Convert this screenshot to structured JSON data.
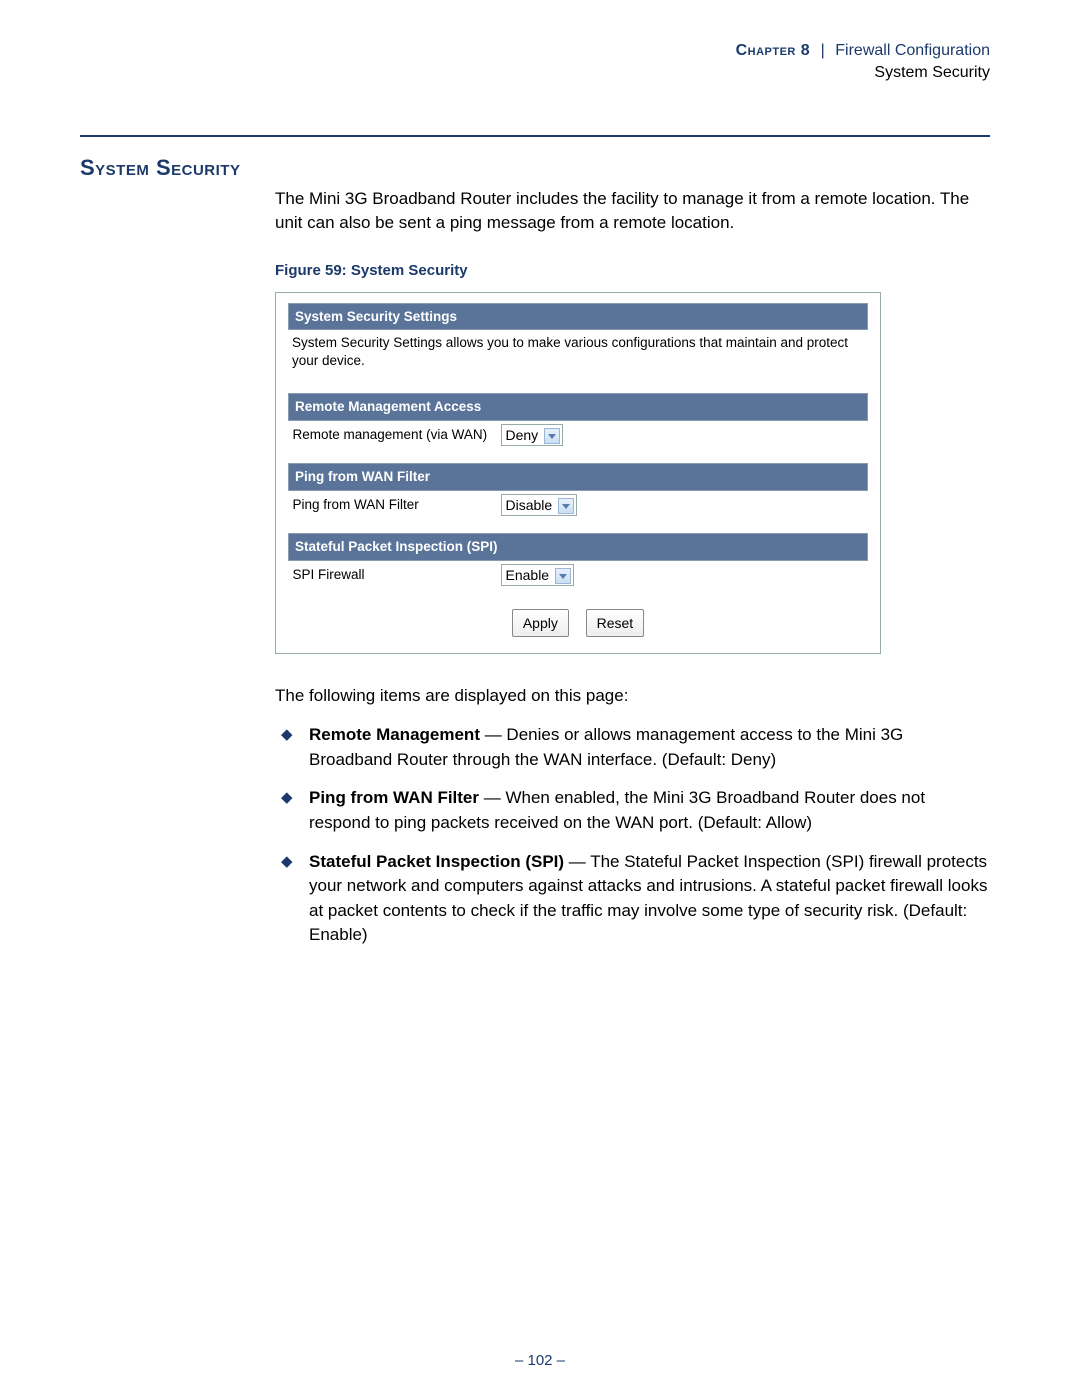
{
  "header": {
    "chapter_label": "Chapter 8",
    "separator": "|",
    "chapter_title": "Firewall Configuration",
    "subsection": "System Security"
  },
  "section_title": "System Security",
  "intro_paragraph": "The Mini 3G Broadband Router includes the facility to manage it from a remote location. The unit can also be sent a ping message from a remote location.",
  "figure_caption": "Figure 59:  System Security",
  "screenshot": {
    "main_title": "System Security Settings",
    "main_desc": "System Security Settings allows you to make various configurations that maintain and protect your device.",
    "groups": [
      {
        "heading": "Remote Management Access",
        "row_label": "Remote management (via WAN)",
        "select_value": "Deny"
      },
      {
        "heading": "Ping from WAN Filter",
        "row_label": "Ping from WAN Filter",
        "select_value": "Disable"
      },
      {
        "heading": "Stateful Packet Inspection (SPI)",
        "row_label": "SPI Firewall",
        "select_value": "Enable"
      }
    ],
    "apply_label": "Apply",
    "reset_label": "Reset"
  },
  "followup_text": "The following items are displayed on this page:",
  "items": [
    {
      "term": "Remote Management",
      "desc": " — Denies or allows management access to the Mini 3G Broadband Router through the WAN interface. (Default: Deny)"
    },
    {
      "term": "Ping from WAN Filter",
      "desc": " — When enabled, the Mini 3G Broadband Router does not respond to ping packets received on the WAN port. (Default: Allow)"
    },
    {
      "term": "Stateful Packet Inspection (SPI)",
      "desc": " — The Stateful Packet Inspection (SPI) firewall protects your network and computers against attacks and intrusions. A stateful packet firewall looks at packet contents to check if the traffic may involve some type of security risk. (Default: Enable)"
    }
  ],
  "page_number": "–  102  –"
}
